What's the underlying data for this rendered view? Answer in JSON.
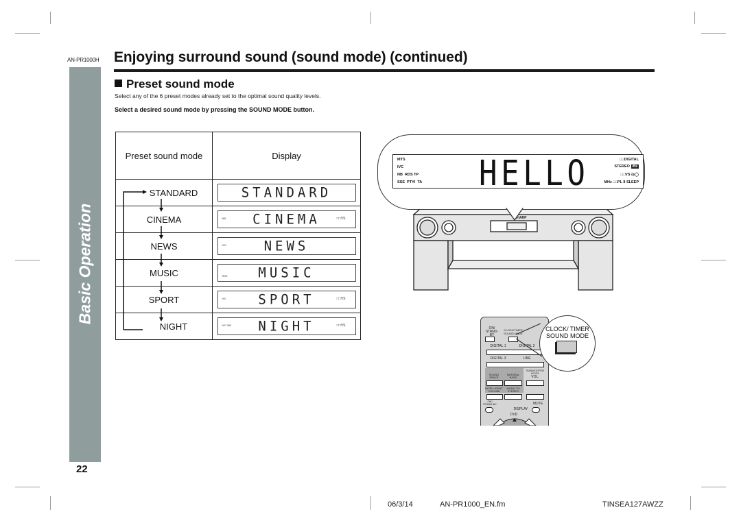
{
  "header": {
    "model": "AN-PR1000H",
    "title": "Enjoying surround sound (sound mode) (continued)"
  },
  "sidebar": {
    "section": "Basic Operation",
    "page_number": "22"
  },
  "section": {
    "title": "Preset sound mode",
    "intro": "Select any of the 6 preset modes already set to the optimal sound quality levels.",
    "instruction": "Select a desired sound mode by pressing the SOUND MODE button."
  },
  "table": {
    "headers": [
      "Preset sound mode",
      "Display"
    ],
    "rows": [
      {
        "mode": "STANDARD",
        "display": "STANDARD",
        "left_ind": "",
        "right_ind": ""
      },
      {
        "mode": "CINEMA",
        "display": "CINEMA",
        "left_ind": "NB",
        "right_ind": "□□VS"
      },
      {
        "mode": "NEWS",
        "display": "NEWS",
        "left_ind": "IVC",
        "right_ind": ""
      },
      {
        "mode": "MUSIC",
        "display": "MUSIC",
        "left_ind": "SSE",
        "right_ind": ""
      },
      {
        "mode": "SPORT",
        "display": "SPORT",
        "left_ind": "IVC",
        "right_ind": "□□VS"
      },
      {
        "mode": "NIGHT",
        "display": "NIGHT",
        "left_ind": "IVC NB",
        "right_ind": "□□VS"
      }
    ]
  },
  "front_display": {
    "main_text": "HELLO",
    "left_indicators": [
      "MTS",
      "IVC",
      "NB  RDS TP",
      "SSE  PTYI  TA"
    ],
    "right_indicators": [
      "□□DIGITAL",
      "STEREO",
      "□□VS",
      "MHz □□PL II SLEEP"
    ],
    "dts_badge": "dts"
  },
  "unit": {
    "brand": "SHARP"
  },
  "remote": {
    "labels": {
      "on_standby": "ON/ STAND-BY",
      "clock_timer_sound_mode": "CLOCK/TIMER SOUND MODE",
      "digital1": "DIGITAL 1",
      "digital2": "DIGITAL 2",
      "digital3": "DIGITAL 3",
      "line": "LINE",
      "sound_space": "SOUND SPACE",
      "natural_bass": "NATURAL BASS",
      "subwoofer_level": "SUBWOOFER LEVEL",
      "vol": "VOL.",
      "intelligent_volume": "INTELLIGENT VOLUME",
      "mono_to_stereo": "MONO TO STEREO",
      "on_standby2": "ON/ STAND-BY",
      "mute": "MUTE",
      "display": "DISPLAY",
      "dvd": "DVD"
    },
    "callout": "CLOCK/ TIMER SOUND MODE"
  },
  "footer": {
    "date": "06/3/14",
    "file": "AN-PR1000_EN.fm",
    "code": "TINSEA127AWZZ"
  }
}
